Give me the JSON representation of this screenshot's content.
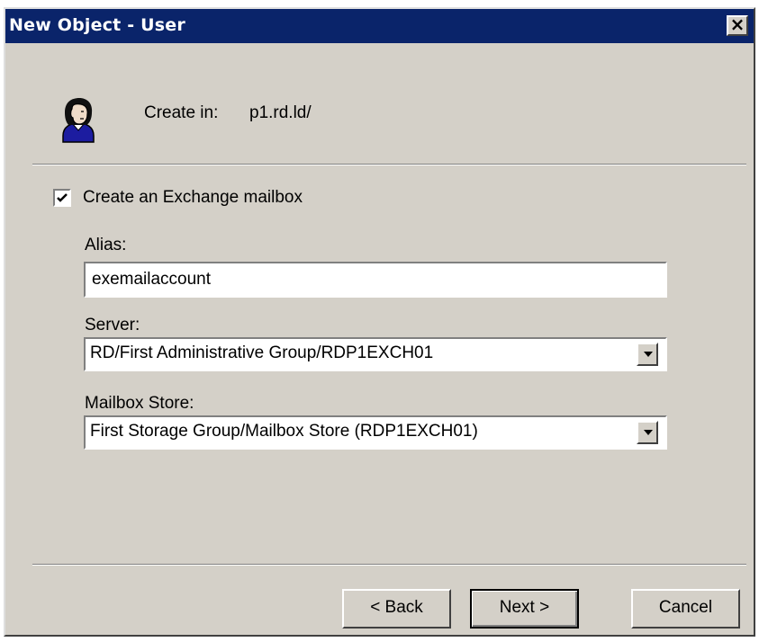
{
  "window": {
    "title": "New Object - User",
    "close_glyph": "×"
  },
  "header": {
    "icon": "user-icon",
    "create_in_label": "Create in:",
    "create_in_value": "p1.rd.ld/"
  },
  "mailbox": {
    "checkbox_label": "Create an Exchange mailbox",
    "checked": true,
    "alias_label": "Alias:",
    "alias_value": "exemailaccount",
    "server_label": "Server:",
    "server_value": "RD/First Administrative Group/RDP1EXCH01",
    "store_label": "Mailbox Store:",
    "store_value": "First Storage Group/Mailbox Store (RDP1EXCH01)"
  },
  "buttons": {
    "back": "< Back",
    "next": "Next >",
    "cancel": "Cancel"
  },
  "colors": {
    "titlebar": "#0a246a",
    "face": "#d4d0c8"
  }
}
